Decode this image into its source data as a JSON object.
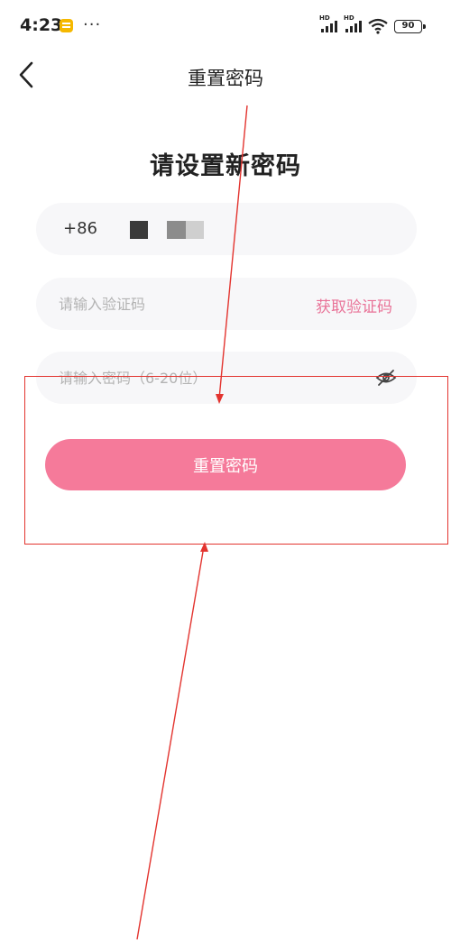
{
  "status_bar": {
    "time": "4:23",
    "dots": "···",
    "signal_label_1": "HD",
    "signal_label_2": "HD",
    "battery": "90"
  },
  "header": {
    "title": "重置密码"
  },
  "form": {
    "heading": "请设置新密码",
    "country_code": "+86",
    "code_placeholder": "请输入验证码",
    "get_code_label": "获取验证码",
    "password_placeholder": "请输入密码（6-20位）",
    "submit_label": "重置密码"
  },
  "colors": {
    "accent": "#f57a9a",
    "link": "#e97398",
    "annotation": "#e3342f"
  },
  "icons": {
    "back": "chevron-left-icon",
    "visibility": "eye-off-icon",
    "wifi": "wifi-icon",
    "battery": "battery-icon",
    "notification": "notification-icon"
  }
}
